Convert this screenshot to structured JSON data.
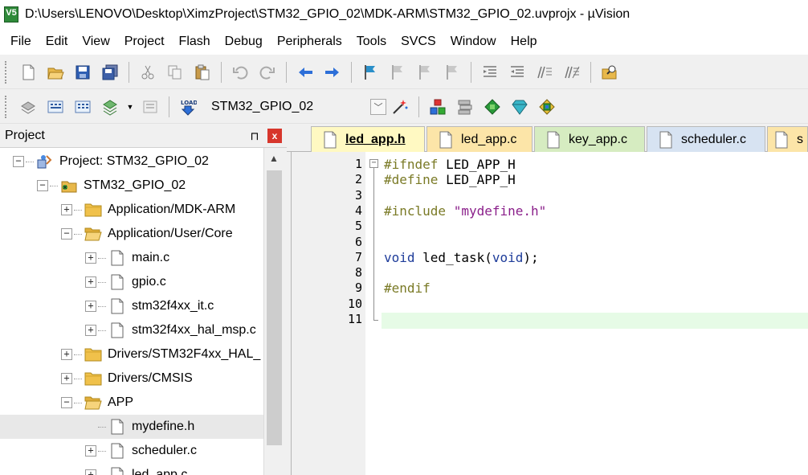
{
  "window": {
    "title": "D:\\Users\\LENOVO\\Desktop\\XimzProject\\STM32_GPIO_02\\MDK-ARM\\STM32_GPIO_02.uvprojx - µVision",
    "app_icon_text": "V5"
  },
  "menu": [
    "File",
    "Edit",
    "View",
    "Project",
    "Flash",
    "Debug",
    "Peripherals",
    "Tools",
    "SVCS",
    "Window",
    "Help"
  ],
  "build_toolbar": {
    "target_name": "STM32_GPIO_02",
    "load_label": "LOAD"
  },
  "project_panel": {
    "title": "Project",
    "pin_glyph": "⊓",
    "close_glyph": "x",
    "tree": [
      {
        "label": "Project: STM32_GPIO_02",
        "level": 0,
        "expander": "−",
        "icon": "project-icon"
      },
      {
        "label": "STM32_GPIO_02",
        "level": 1,
        "expander": "−",
        "icon": "target-icon"
      },
      {
        "label": "Application/MDK-ARM",
        "level": 2,
        "expander": "+",
        "icon": "folder-icon"
      },
      {
        "label": "Application/User/Core",
        "level": 2,
        "expander": "−",
        "icon": "folder-open-icon"
      },
      {
        "label": "main.c",
        "level": 3,
        "expander": "+",
        "icon": "file-icon"
      },
      {
        "label": "gpio.c",
        "level": 3,
        "expander": "+",
        "icon": "file-icon"
      },
      {
        "label": "stm32f4xx_it.c",
        "level": 3,
        "expander": "+",
        "icon": "file-icon"
      },
      {
        "label": "stm32f4xx_hal_msp.c",
        "level": 3,
        "expander": "+",
        "icon": "file-icon"
      },
      {
        "label": "Drivers/STM32F4xx_HAL_",
        "level": 2,
        "expander": "+",
        "icon": "folder-icon"
      },
      {
        "label": "Drivers/CMSIS",
        "level": 2,
        "expander": "+",
        "icon": "folder-icon"
      },
      {
        "label": "APP",
        "level": 2,
        "expander": "−",
        "icon": "folder-open-icon"
      },
      {
        "label": "mydefine.h",
        "level": 3,
        "expander": "",
        "icon": "file-icon",
        "selected": true
      },
      {
        "label": "scheduler.c",
        "level": 3,
        "expander": "+",
        "icon": "file-icon"
      },
      {
        "label": "led_app.c",
        "level": 3,
        "expander": "+",
        "icon": "file-icon"
      }
    ]
  },
  "editor": {
    "tabs": [
      {
        "label": "led_app.h",
        "active": true
      },
      {
        "label": "led_app.c",
        "active": false
      },
      {
        "label": "key_app.c",
        "active": false
      },
      {
        "label": "scheduler.c",
        "active": false
      },
      {
        "label": "s",
        "active": false
      }
    ],
    "lines": [
      {
        "num": "1",
        "tokens": [
          {
            "t": "#ifndef ",
            "c": "pp"
          },
          {
            "t": "LED_APP_H",
            "c": ""
          }
        ]
      },
      {
        "num": "2",
        "tokens": [
          {
            "t": "#define ",
            "c": "pp"
          },
          {
            "t": "LED_APP_H",
            "c": ""
          }
        ]
      },
      {
        "num": "3",
        "tokens": []
      },
      {
        "num": "4",
        "tokens": [
          {
            "t": "#include ",
            "c": "pp"
          },
          {
            "t": "\"mydefine.h\"",
            "c": "str"
          }
        ]
      },
      {
        "num": "5",
        "tokens": []
      },
      {
        "num": "6",
        "tokens": []
      },
      {
        "num": "7",
        "tokens": [
          {
            "t": "void",
            "c": "kw"
          },
          {
            "t": " led_task(",
            "c": ""
          },
          {
            "t": "void",
            "c": "kw"
          },
          {
            "t": ");",
            "c": ""
          }
        ]
      },
      {
        "num": "8",
        "tokens": []
      },
      {
        "num": "9",
        "tokens": [
          {
            "t": "#endif",
            "c": "pp"
          }
        ]
      },
      {
        "num": "10",
        "tokens": []
      },
      {
        "num": "11",
        "tokens": []
      }
    ]
  }
}
